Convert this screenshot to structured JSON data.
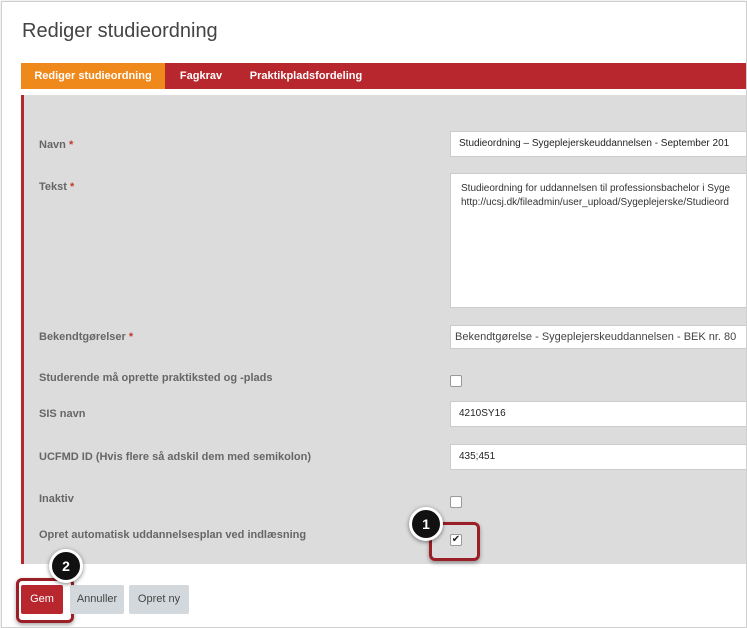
{
  "page": {
    "title": "Rediger studieordning"
  },
  "tabs": [
    {
      "label": "Rediger studieordning",
      "active": true
    },
    {
      "label": "Fagkrav",
      "active": false
    },
    {
      "label": "Praktikpladsfordeling",
      "active": false
    }
  ],
  "form": {
    "required_mark": "*",
    "navn": {
      "label": "Navn",
      "value": "Studieordning – Sygeplejerskeuddannelsen - September 201"
    },
    "tekst": {
      "label": "Tekst",
      "line1": "Studieordning for uddannelsen til professionsbachelor i Syge",
      "line2": "http://ucsj.dk/fileadmin/user_upload/Sygeplejerske/Studieord"
    },
    "bekendtgorelser": {
      "label": "Bekendtgørelser",
      "value": "Bekendtgørelse - Sygeplejerskeuddannelsen - BEK nr. 80"
    },
    "praktiksted": {
      "label": "Studerende må oprette praktiksted og -plads",
      "checked": false
    },
    "sis_navn": {
      "label": "SIS navn",
      "value": "4210SY16"
    },
    "ucfmd_id": {
      "label": "UCFMD ID (Hvis flere så adskil dem med semikolon)",
      "value": "435;451"
    },
    "inaktiv": {
      "label": "Inaktiv",
      "checked": false
    },
    "auto_plan": {
      "label": "Opret automatisk uddannelsesplan ved indlæsning",
      "checked": true,
      "check_glyph": "✔"
    }
  },
  "buttons": {
    "save": "Gem",
    "cancel": "Annuller",
    "create_new": "Opret ny"
  },
  "callouts": {
    "one": "1",
    "two": "2"
  },
  "colors": {
    "brand_red": "#b8272d",
    "active_tab": "#f0891b",
    "panel": "#dcdcdc"
  }
}
